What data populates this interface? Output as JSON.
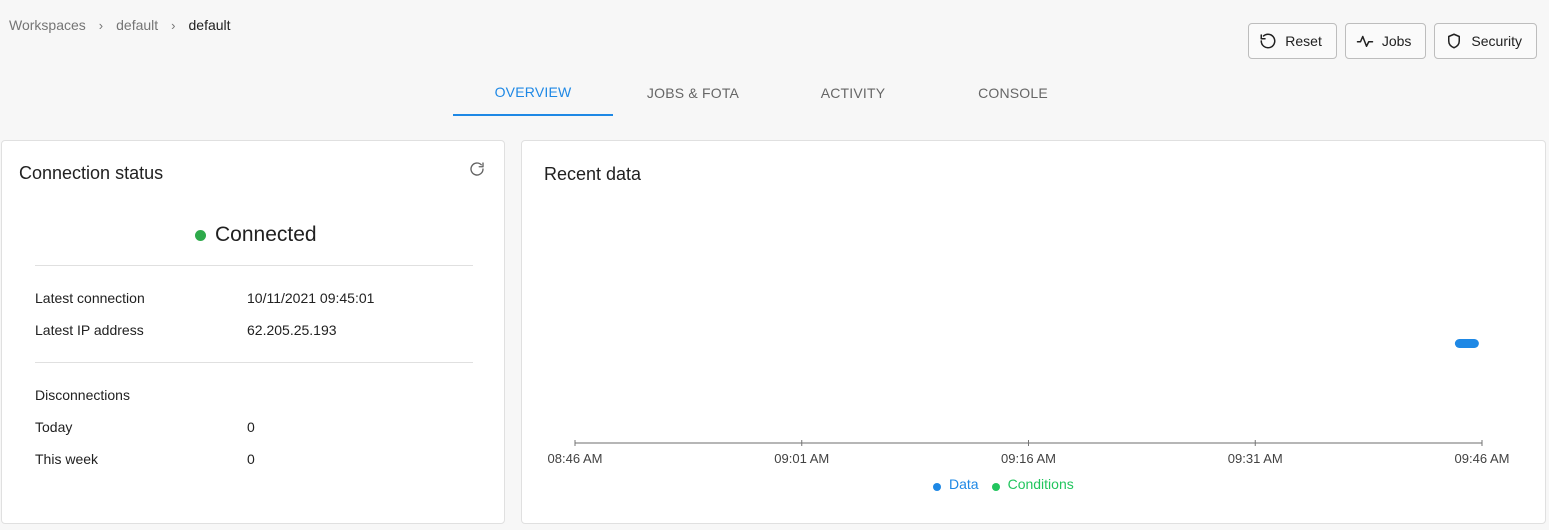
{
  "breadcrumb": {
    "items": [
      "Workspaces",
      "default",
      "default"
    ],
    "separator": "›"
  },
  "actions": {
    "reset_label": "Reset",
    "jobs_label": "Jobs",
    "security_label": "Security"
  },
  "tabs": [
    {
      "label": "OVERVIEW",
      "active": true
    },
    {
      "label": "JOBS & FOTA",
      "active": false
    },
    {
      "label": "ACTIVITY",
      "active": false
    },
    {
      "label": "CONSOLE",
      "active": false
    }
  ],
  "connection_card": {
    "title": "Connection status",
    "status": "Connected",
    "status_color": "#2eaa4b",
    "latest_connection_label": "Latest connection",
    "latest_connection_value": "10/11/2021 09:45:01",
    "latest_ip_label": "Latest IP address",
    "latest_ip_value": "62.205.25.193",
    "disconnections_label": "Disconnections",
    "today_label": "Today",
    "today_value": "0",
    "week_label": "This week",
    "week_value": "0"
  },
  "recent_data_card": {
    "title": "Recent data"
  },
  "chart_data": {
    "type": "scatter",
    "x_tick_labels": [
      "08:46 AM",
      "09:01 AM",
      "09:16 AM",
      "09:31 AM",
      "09:46 AM"
    ],
    "xlim": [
      "08:46 AM",
      "09:46 AM"
    ],
    "series": [
      {
        "name": "Data",
        "color": "#1e88e5",
        "points": [
          {
            "x": "09:45 AM",
            "y": 1
          }
        ]
      },
      {
        "name": "Conditions",
        "color": "#22c55e",
        "points": []
      }
    ],
    "legend_position": "bottom-center",
    "grid": false
  }
}
